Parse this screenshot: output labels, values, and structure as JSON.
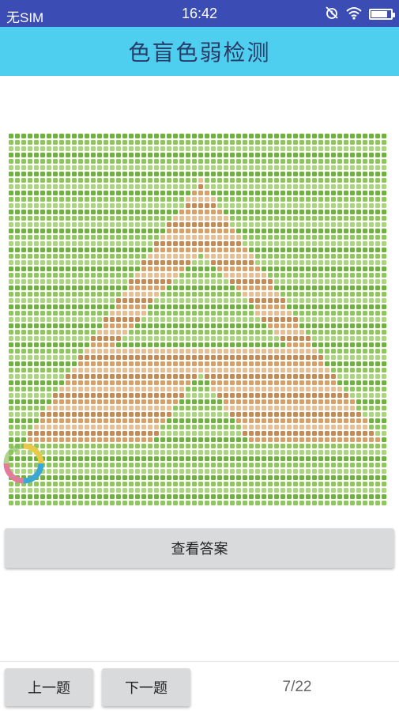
{
  "status_bar": {
    "carrier": "无SIM",
    "time": "16:42",
    "icons": [
      "alarm-off-icon",
      "wifi-icon",
      "battery-icon"
    ]
  },
  "header": {
    "title": "色盲色弱检测"
  },
  "plate": {
    "background_colors": [
      "#6cb33a",
      "#8fc85a",
      "#a9d67a"
    ],
    "figure_colors": [
      "#d9a066",
      "#e8bf94",
      "#c98a52"
    ]
  },
  "answer_button": {
    "label": "查看答案"
  },
  "footer": {
    "prev_label": "上一题",
    "next_label": "下一题",
    "progress": "7/22"
  },
  "colors": {
    "status_bar": "#3b4db5",
    "header": "#4fcfef",
    "button": "#d8dadc"
  }
}
